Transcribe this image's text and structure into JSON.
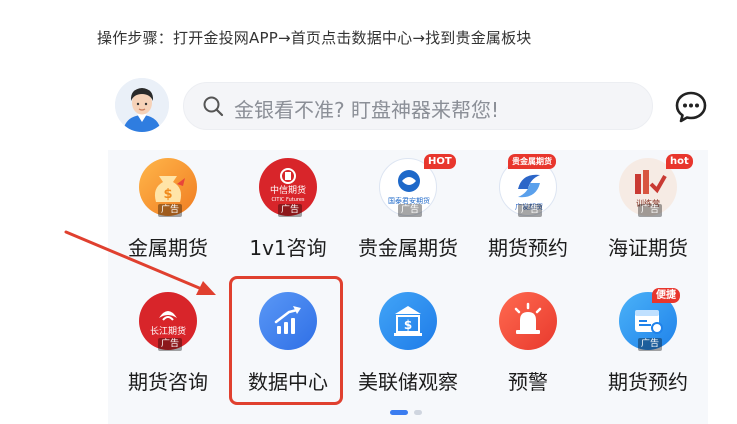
{
  "instruction": "操作步骤：打开金投网APP→首页点击数据中心→找到贵金属板块",
  "search": {
    "placeholder": "金银看不准? 盯盘神器来帮您!",
    "icon": "search-icon"
  },
  "header_icons": {
    "avatar": "avatar",
    "chat": "chat-icon"
  },
  "grid": {
    "row1": [
      {
        "label": "金属期货",
        "icon": "money-bag-icon",
        "ad": "广告",
        "color": "#f7a23a"
      },
      {
        "label": "1v1咨询",
        "icon": "citic-futures-logo-icon",
        "ad": "广告",
        "logo_text": "中信期货",
        "logo_sub": "CITIC Futures",
        "color": "#d8252a"
      },
      {
        "label": "贵金属期货",
        "icon": "guotai-junan-logo-icon",
        "ad": "广告",
        "badge": "HOT",
        "logo_text": "国泰君安期货",
        "color": "#1d68c9"
      },
      {
        "label": "期货预约",
        "icon": "gf-futures-logo-icon",
        "ad": "广告",
        "badge": "贵金属期货",
        "logo_text": "广发期货",
        "color": "#2c66c8"
      },
      {
        "label": "海证期货",
        "icon": "training-camp-icon",
        "ad": "广告",
        "badge": "hot",
        "logo_text": "训练营",
        "color": "#d0483e"
      }
    ],
    "row2": [
      {
        "label": "期货咨询",
        "icon": "changjiang-futures-logo-icon",
        "ad": "广告",
        "logo_text": "长江期货",
        "color": "#d8252a"
      },
      {
        "label": "数据中心",
        "icon": "trend-chart-icon",
        "color": "#3b7df0"
      },
      {
        "label": "美联储观察",
        "icon": "bank-building-icon",
        "color": "#2f8cf2"
      },
      {
        "label": "预警",
        "icon": "alarm-siren-icon",
        "color": "#ef4d3c"
      },
      {
        "label": "期货预约",
        "icon": "calendar-user-icon",
        "ad": "广告",
        "badge": "便捷",
        "color": "#2f8cf2"
      }
    ]
  },
  "accent_colors": {
    "highlight": "#e0402f",
    "pager_active": "#3b7df0",
    "pager_inactive": "#cfd5df"
  }
}
